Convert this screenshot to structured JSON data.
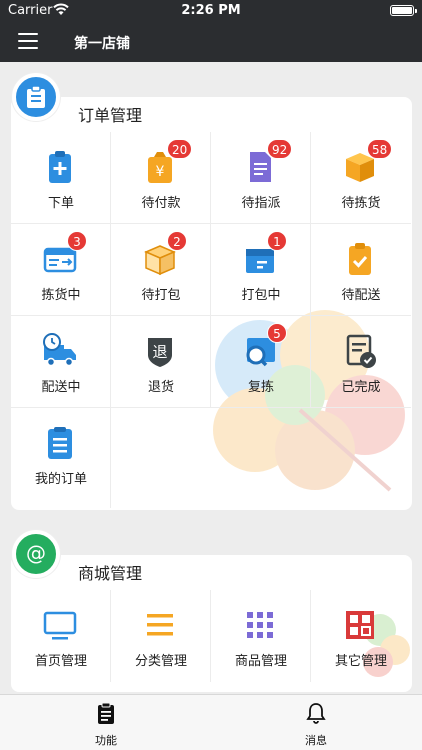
{
  "status_bar": {
    "carrier": "Carrier",
    "time": "2:26 PM"
  },
  "nav": {
    "title": "第一店铺",
    "menu_icon": "hamburger-menu-icon"
  },
  "sections": [
    {
      "title": "订单管理",
      "icon": "clipboard-icon",
      "items": [
        {
          "label": "下单",
          "icon": "clipboard-plus-icon",
          "badge": ""
        },
        {
          "label": "待付款",
          "icon": "yen-bag-icon",
          "badge": "20"
        },
        {
          "label": "待指派",
          "icon": "document-lines-icon",
          "badge": "92"
        },
        {
          "label": "待拣货",
          "icon": "box-icon",
          "badge": "58"
        },
        {
          "label": "拣货中",
          "icon": "picking-truck-icon",
          "badge": "3"
        },
        {
          "label": "待打包",
          "icon": "open-box-icon",
          "badge": "2"
        },
        {
          "label": "打包中",
          "icon": "packing-box-icon",
          "badge": "1"
        },
        {
          "label": "待配送",
          "icon": "clipboard-check-icon",
          "badge": ""
        },
        {
          "label": "配送中",
          "icon": "delivery-truck-icon",
          "badge": ""
        },
        {
          "label": "退货",
          "icon": "return-shield-icon",
          "badge": ""
        },
        {
          "label": "复拣",
          "icon": "magnifier-box-icon",
          "badge": "5"
        },
        {
          "label": "已完成",
          "icon": "document-check-icon",
          "badge": ""
        },
        {
          "label": "我的订单",
          "icon": "order-list-icon",
          "badge": ""
        }
      ]
    },
    {
      "title": "商城管理",
      "icon": "at-sign-icon",
      "items": [
        {
          "label": "首页管理",
          "icon": "monitor-icon"
        },
        {
          "label": "分类管理",
          "icon": "category-lines-icon"
        },
        {
          "label": "商品管理",
          "icon": "grid-dots-icon"
        },
        {
          "label": "其它管理",
          "icon": "other-squares-icon"
        }
      ]
    }
  ],
  "tabs": [
    {
      "label": "功能",
      "icon": "clipboard-tab-icon"
    },
    {
      "label": "消息",
      "icon": "bell-icon"
    }
  ],
  "colors": {
    "bar": "#2b2d30",
    "blue": "#2d8ee0",
    "green": "#24ad5f",
    "badge": "#e53935",
    "orange": "#f5a623",
    "purple": "#7c6bd6"
  }
}
